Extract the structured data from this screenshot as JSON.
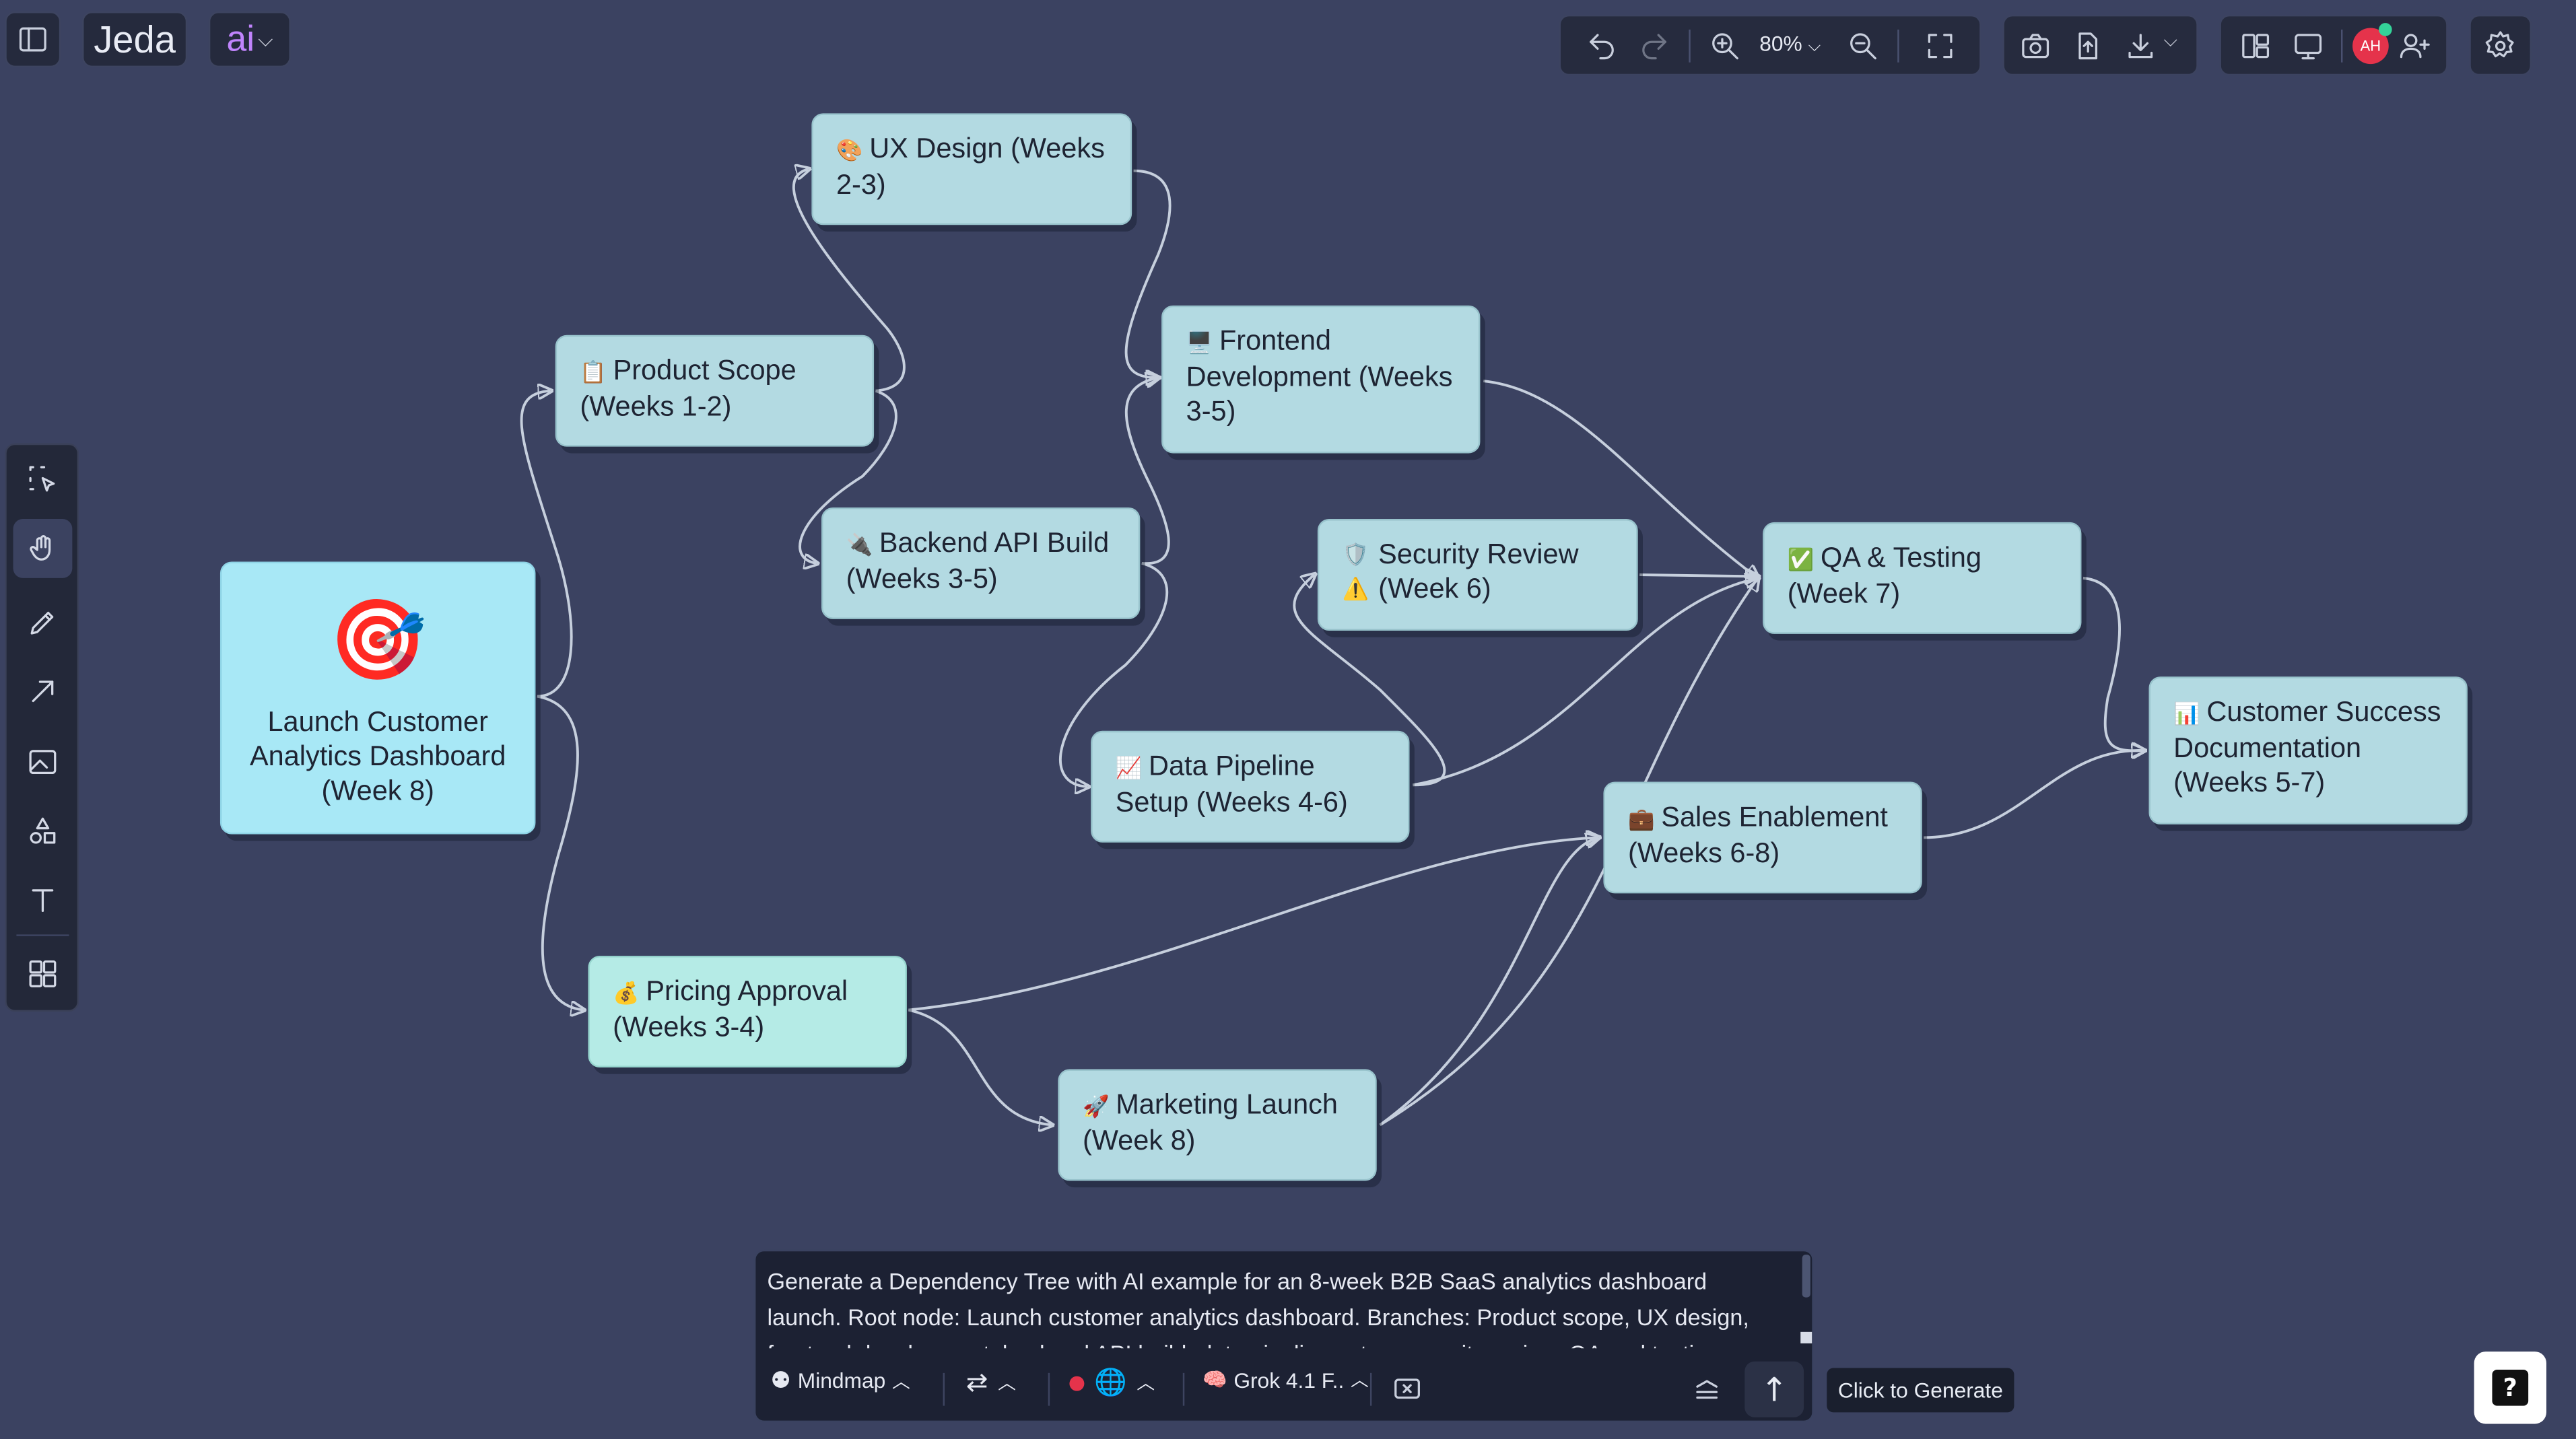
{
  "app": {
    "logo_text": "Jeda",
    "ai_label": "ai"
  },
  "toolbar": {
    "zoom_level": "80%",
    "avatar_initials": "AH"
  },
  "nodes": {
    "root": {
      "emoji": "🎯",
      "label": "Launch Customer Analytics Dashboard (Week 8)"
    },
    "product_scope": {
      "emoji": "📋",
      "label": "Product Scope (Weeks 1-2)"
    },
    "ux_design": {
      "emoji": "🎨",
      "label": "UX Design (Weeks 2-3)"
    },
    "backend_api": {
      "emoji": "🔌",
      "label": "Backend API Build (Weeks 3-5)"
    },
    "frontend_dev": {
      "emoji": "🖥️",
      "label": "Frontend Development (Weeks 3-5)"
    },
    "security_review": {
      "emoji": "🛡️",
      "emoji2": "⚠️",
      "label": "Security Review (Week 6)"
    },
    "data_pipeline": {
      "emoji": "📈",
      "label": "Data Pipeline Setup (Weeks 4-6)"
    },
    "qa_testing": {
      "emoji": "✅",
      "label": "QA & Testing (Week 7)"
    },
    "customer_success": {
      "emoji": "📊",
      "label": "Customer Success Documentation (Weeks 5-7)"
    },
    "sales_enablement": {
      "emoji": "💼",
      "label": "Sales Enablement (Weeks 6-8)"
    },
    "pricing_approval": {
      "emoji": "💰",
      "label": "Pricing Approval (Weeks 3-4)"
    },
    "marketing_launch": {
      "emoji": "🚀",
      "label": "Marketing Launch (Week 8)"
    }
  },
  "prompt": {
    "text": "Generate a Dependency Tree with AI example for an 8-week B2B SaaS analytics dashboard launch. Root node: Launch customer analytics dashboard. Branches: Product scope, UX design, frontend development, backend API build, data pipeline setup, security review, QA and testing, sales enablement, pricing approval.",
    "mode_label": "Mindmap",
    "model_label": "Grok 4.1 F..",
    "generate_tooltip": "Click to Generate"
  },
  "colors": {
    "canvas": "#3b4261",
    "node": "#b3dae2",
    "root_node": "#a8e8f6",
    "pricing_node": "#b5ebe6",
    "accent": "#a855f7",
    "status_dot": "#e5334b"
  }
}
